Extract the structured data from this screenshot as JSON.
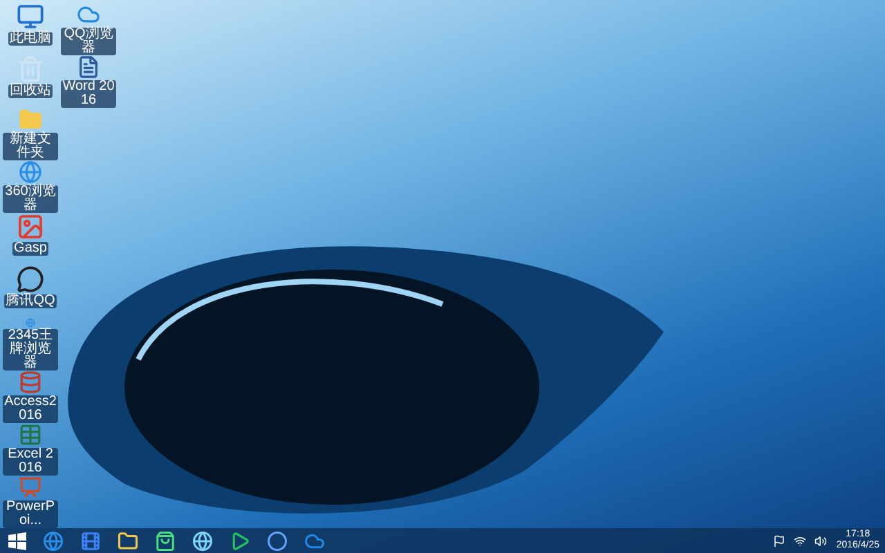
{
  "desktop": {
    "columns": [
      [
        {
          "label": "此电脑",
          "kind": "computer"
        },
        {
          "label": "回收站",
          "kind": "recycle"
        },
        {
          "label": "新建文件夹",
          "kind": "folder"
        },
        {
          "label": "360浏览器",
          "kind": "browser"
        },
        {
          "label": "Gasp",
          "kind": "app"
        },
        {
          "label": "腾讯QQ",
          "kind": "penguin"
        },
        {
          "label": "2345王牌浏览器",
          "kind": "browser"
        },
        {
          "label": "Access2016",
          "kind": "access"
        },
        {
          "label": "Excel 2016",
          "kind": "excel"
        },
        {
          "label": "PowerPoi...",
          "kind": "powerpoint"
        }
      ],
      [
        {
          "label": "QQ浏览器",
          "kind": "cloud"
        },
        {
          "label": "Word 2016",
          "kind": "word"
        }
      ]
    ]
  },
  "taskbar": {
    "pinned": [
      {
        "kind": "start"
      },
      {
        "kind": "browser"
      },
      {
        "kind": "video"
      },
      {
        "kind": "folder"
      },
      {
        "kind": "store"
      },
      {
        "kind": "globe"
      },
      {
        "kind": "media"
      },
      {
        "kind": "k"
      },
      {
        "kind": "cloud"
      }
    ],
    "clock": {
      "time": "17:18",
      "date": "2016/4/25"
    }
  }
}
